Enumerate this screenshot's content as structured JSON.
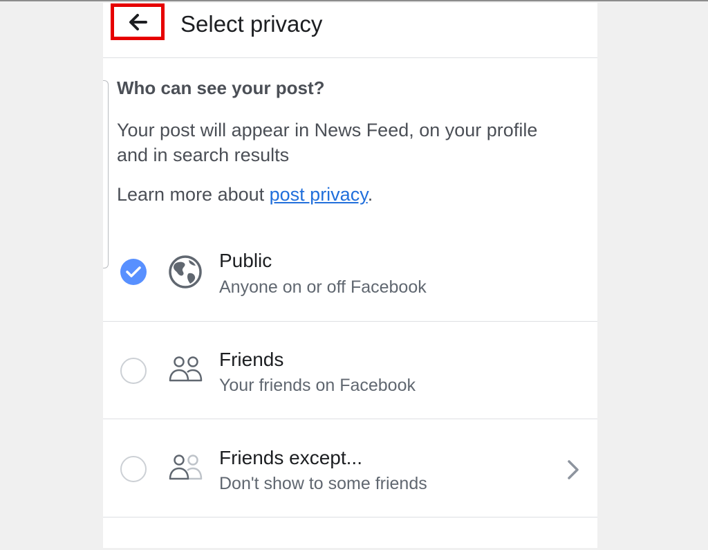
{
  "header": {
    "title": "Select privacy",
    "back_icon": "arrow-left-icon"
  },
  "info": {
    "heading": "Who can see your post?",
    "description": "Your post will appear in News Feed, on your profile and in search results",
    "learn_prefix": "Learn more about ",
    "learn_link": "post privacy",
    "learn_suffix": "."
  },
  "options": [
    {
      "title": "Public",
      "subtitle": "Anyone on or off Facebook",
      "selected": true,
      "icon": "globe-icon"
    },
    {
      "title": "Friends",
      "subtitle": "Your friends on Facebook",
      "selected": false,
      "icon": "friends-icon"
    },
    {
      "title": "Friends except...",
      "subtitle": "Don't show to some friends",
      "selected": false,
      "icon": "friends-except-icon",
      "chevron_icon": "chevron-right-icon"
    }
  ],
  "colors": {
    "accent": "#5890ff",
    "link": "#216fdb",
    "highlight": "#e60000"
  }
}
